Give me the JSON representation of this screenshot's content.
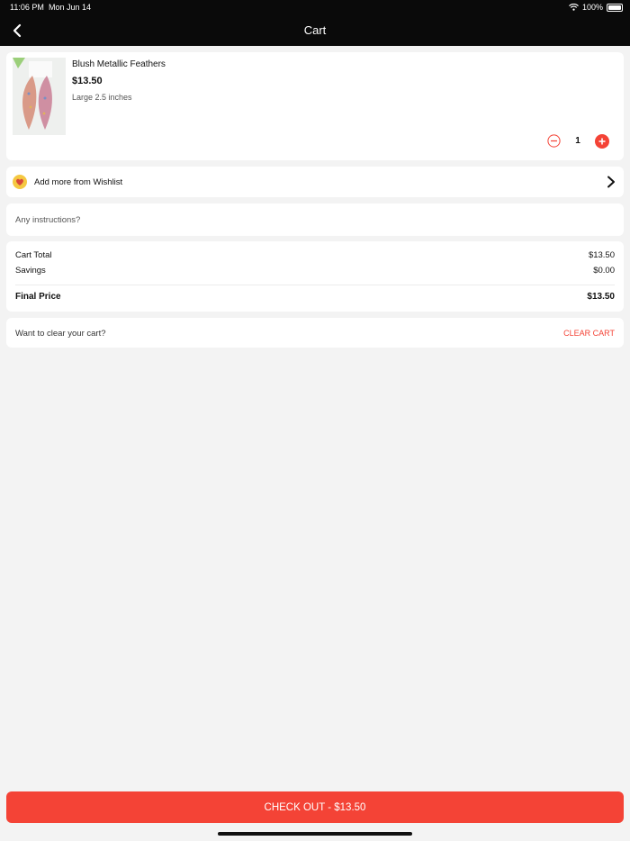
{
  "status_bar": {
    "time": "11:06 PM",
    "date": "Mon Jun 14",
    "battery": "100%"
  },
  "header": {
    "title": "Cart",
    "back_icon": "chevron-left-icon"
  },
  "cart_item": {
    "name": "Blush Metallic Feathers",
    "price": "$13.50",
    "variant": "Large 2.5 inches",
    "quantity": "1"
  },
  "wishlist": {
    "label": "Add more from Wishlist",
    "icon": "heart-icon"
  },
  "instructions": {
    "placeholder": "Any instructions?"
  },
  "totals": {
    "cart_total_label": "Cart Total",
    "cart_total_value": "$13.50",
    "savings_label": "Savings",
    "savings_value": "$0.00",
    "final_label": "Final Price",
    "final_value": "$13.50"
  },
  "clear_cart": {
    "prompt": "Want to clear your cart?",
    "button": "CLEAR CART"
  },
  "checkout": {
    "label": "CHECK OUT - $13.50"
  },
  "colors": {
    "accent": "#f44336",
    "header_bg": "#0a0a0a",
    "page_bg": "#f3f3f3"
  }
}
